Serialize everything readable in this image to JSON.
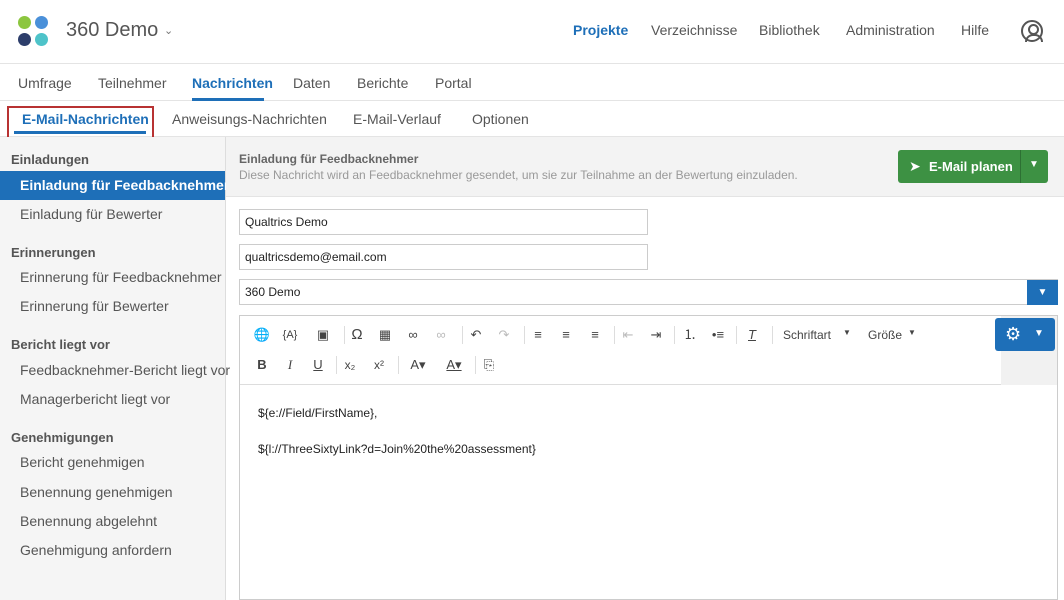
{
  "app": {
    "title": "360 Demo",
    "chevron": "⌄"
  },
  "topnav": [
    "Projekte",
    "Verzeichnisse",
    "Bibliothek",
    "Administration",
    "Hilfe"
  ],
  "tabs": [
    "Umfrage",
    "Teilnehmer",
    "Nachrichten",
    "Daten",
    "Berichte",
    "Portal"
  ],
  "subtabs": [
    "E-Mail-Nachrichten",
    "Anweisungs-Nachrichten",
    "E-Mail-Verlauf",
    "Optionen"
  ],
  "sidebar": {
    "groups": [
      {
        "heading": "Einladungen",
        "items": [
          "Einladung für Feedbacknehmer",
          "Einladung für Bewerter"
        ]
      },
      {
        "heading": "Erinnerungen",
        "items": [
          "Erinnerung für Feedbacknehmer",
          "Erinnerung für Bewerter"
        ]
      },
      {
        "heading": "Bericht liegt vor",
        "items": [
          "Feedbacknehmer-Bericht liegt vor",
          "Managerbericht liegt vor"
        ]
      },
      {
        "heading": "Genehmigungen",
        "items": [
          "Bericht genehmigen",
          "Benennung genehmigen",
          "Benennung abgelehnt",
          "Genehmigung anfordern"
        ]
      }
    ]
  },
  "message": {
    "title": "Einladung für Feedbacknehmer",
    "subtitle": "Diese Nachricht wird an Feedbacknehmer gesendet, um sie zur Teilnahme an der Bewertung einzuladen.",
    "plan_button": "E-Mail planen"
  },
  "fields": {
    "from_name": "Qualtrics Demo",
    "from_email": "qualtricsdemo@email.com",
    "library": "360 Demo"
  },
  "toolbar": {
    "font": "Schriftart",
    "size": "Größe"
  },
  "body": [
    "${e://Field/FirstName},",
    "${l://ThreeSixtyLink?d=Join%20the%20assessment}"
  ],
  "colors": {
    "accent": "#1e6fb8",
    "green": "#3d9143",
    "highlight_box": "#b83232"
  }
}
